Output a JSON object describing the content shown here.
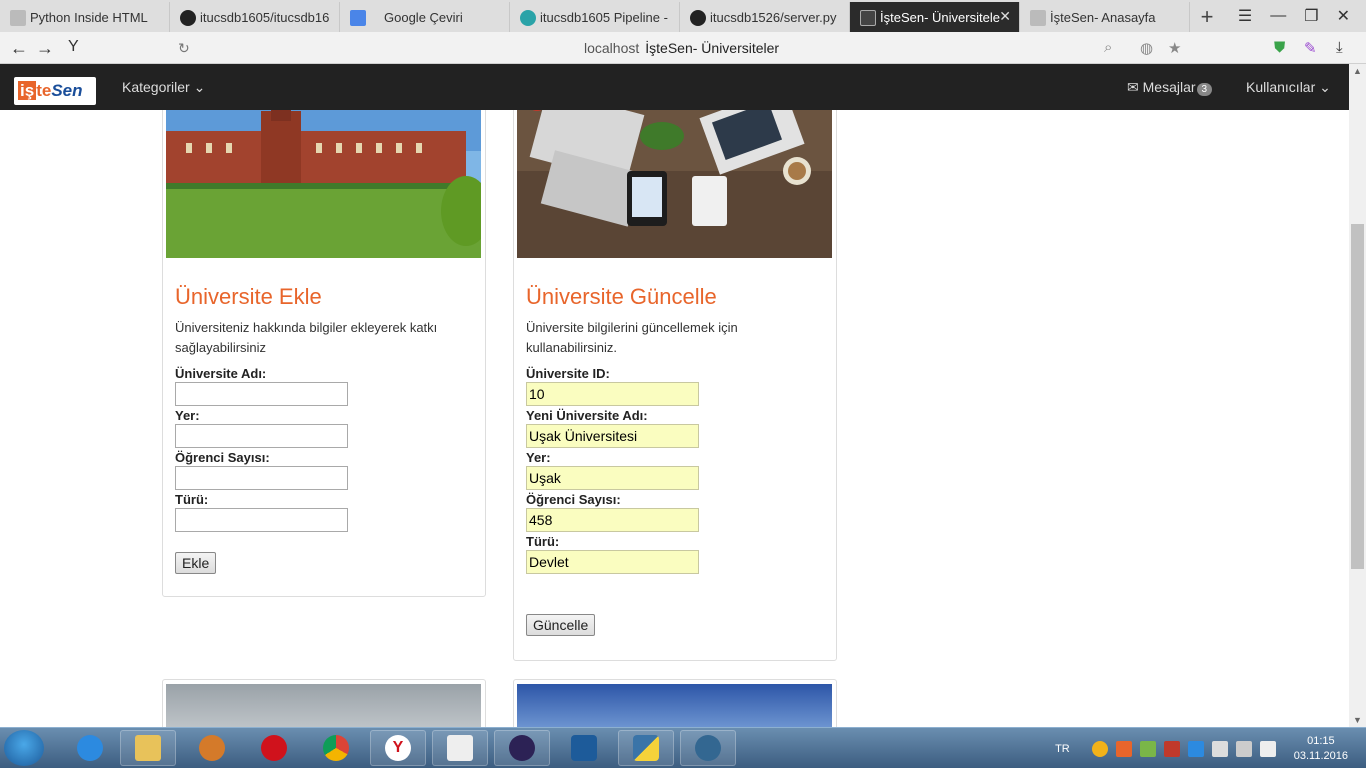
{
  "browser": {
    "tabs": [
      {
        "title": "Python Inside HTML"
      },
      {
        "title": "itucsdb1605/itucsdb16"
      },
      {
        "title": "Google Çeviri"
      },
      {
        "title": "itucsdb1605 Pipeline -"
      },
      {
        "title": "itucsdb1526/server.py"
      },
      {
        "title": "İşteSen- Üniversitele"
      },
      {
        "title": "İşteSen- Anasayfa"
      }
    ],
    "address_host": "localhost",
    "address_title": "İşteSen- Üniversiteler"
  },
  "navbar": {
    "brand_part1": "iş",
    "brand_part2": "te",
    "brand_part3": "Sen",
    "categories": "Kategoriler",
    "messages": "Mesajlar",
    "messages_count": "3",
    "users": "Kullanıcılar"
  },
  "add_card": {
    "title": "Üniversite Ekle",
    "description": "Üniversiteniz hakkında bilgiler ekleyerek katkı sağlayabilirsiniz",
    "label_name": "Üniversite Adı:",
    "label_location": "Yer:",
    "label_students": "Öğrenci Sayısı:",
    "label_type": "Türü:",
    "button": "Ekle"
  },
  "update_card": {
    "title": "Üniversite Güncelle",
    "description": "Üniversite bilgilerini güncellemek için kullanabilirsiniz.",
    "label_id": "Üniversite ID:",
    "value_id": "10",
    "label_new_name": "Yeni Üniversite Adı:",
    "value_new_name": "Uşak Üniversitesi",
    "label_location": "Yer:",
    "value_location": "Uşak",
    "label_students": "Öğrenci Sayısı:",
    "value_students": "458",
    "label_type": "Türü:",
    "value_type": "Devlet",
    "button": "Güncelle"
  },
  "taskbar": {
    "lang": "TR",
    "time": "01:15",
    "date": "03.11.2016"
  }
}
